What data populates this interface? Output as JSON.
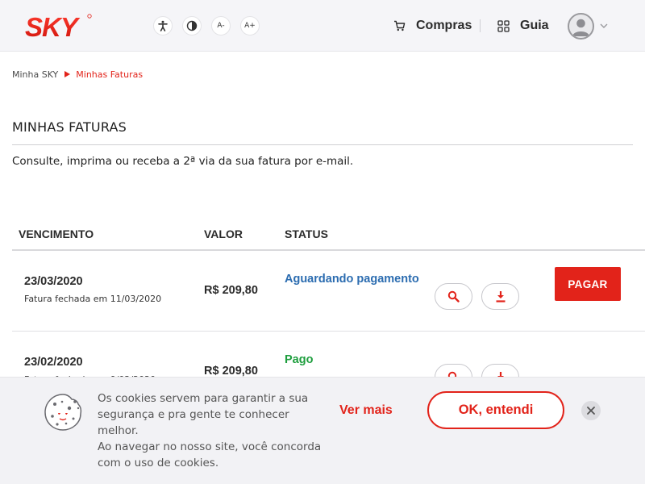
{
  "header": {
    "logo_text": "SKY",
    "accessibility": [
      {
        "name": "accessibility-icon",
        "label": ""
      },
      {
        "name": "contrast-icon",
        "label": ""
      },
      {
        "name": "decrease-font-icon",
        "label": "A-"
      },
      {
        "name": "increase-font-icon",
        "label": "A+"
      }
    ],
    "compras_label": "Compras",
    "guia_label": "Guia",
    "user_menu_icon": "user-avatar-icon"
  },
  "breadcrumb": {
    "root": "Minha SKY",
    "current": "Minhas Faturas"
  },
  "page": {
    "title": "MINHAS FATURAS",
    "subtitle": "Consulte, imprima ou receba a 2ª via da sua fatura por e-mail."
  },
  "table": {
    "headers": {
      "vencimento": "VENCIMENTO",
      "valor": "VALOR",
      "status": "STATUS"
    },
    "rows": [
      {
        "due_date": "23/03/2020",
        "closed_note": "Fatura fechada em 11/03/2020",
        "value": "R$ 209,80",
        "status": "Aguardando pagamento",
        "status_color": "#2b6cb0",
        "pay_label": "PAGAR"
      },
      {
        "due_date": "23/02/2020",
        "closed_note": "Fatura fechada em 9/02/2020",
        "value": "R$ 209,80",
        "status": "Pago",
        "status_color": "#1e9e3e"
      }
    ]
  },
  "cookie_banner": {
    "text_1": "Os cookies servem para garantir a sua segurança e pra gente te conhecer melhor.",
    "text_2": "Ao navegar no nosso site, você concorda com o uso de cookies.",
    "more_label": "Ver mais",
    "ok_label": "OK, entendi"
  },
  "colors": {
    "brand_red": "#e2231a",
    "header_bg": "#f5f5f8"
  }
}
